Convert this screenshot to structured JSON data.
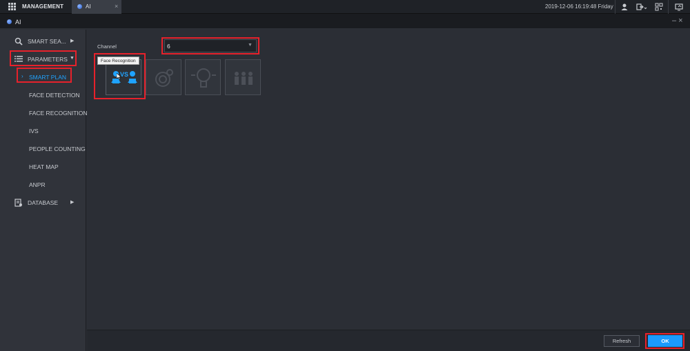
{
  "topbar": {
    "menu_label": "MANAGEMENT",
    "tab_label": "AI",
    "tab_close": "×",
    "datetime": "2019-12-06 16:19:48 Friday"
  },
  "window": {
    "title": "AI",
    "controls": "– ×"
  },
  "sidebar": {
    "smart_search": "SMART SEA...",
    "parameters": "PARAMETERS",
    "sub_items": [
      "SMART PLAN",
      "FACE DETECTION",
      "FACE RECOGNITION",
      "IVS",
      "PEOPLE COUNTING",
      "HEAT MAP",
      "ANPR"
    ],
    "database": "DATABASE"
  },
  "main": {
    "channel_label": "Channel",
    "channel_value": "6",
    "tooltip": "Face Recognition",
    "vs_text": "VS"
  },
  "footer": {
    "refresh_label": "Refresh",
    "ok_label": "OK"
  },
  "colors": {
    "accent": "#1fa3ff",
    "highlight_box": "#e8212b",
    "ok_button": "#1a9bff"
  }
}
